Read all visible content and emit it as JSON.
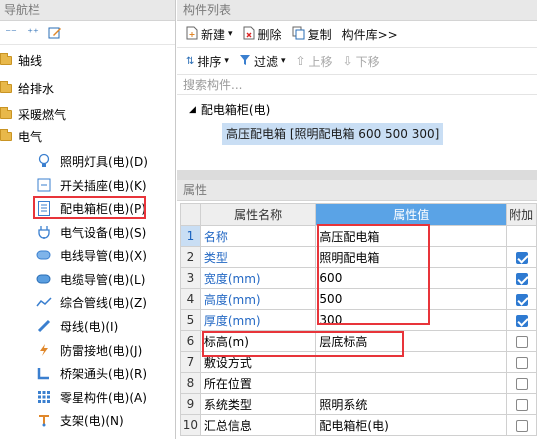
{
  "nav": {
    "title": "导航栏",
    "folders": [
      {
        "label": "轴线"
      },
      {
        "label": "给排水"
      },
      {
        "label": "采暖燃气"
      },
      {
        "label": "电气"
      }
    ],
    "items": [
      {
        "label": "照明灯具(电)(D)",
        "icon": "bulb-icon"
      },
      {
        "label": "开关插座(电)(K)",
        "icon": "switch-icon"
      },
      {
        "label": "配电箱柜(电)(P)",
        "icon": "cabinet-icon"
      },
      {
        "label": "电气设备(电)(S)",
        "icon": "plug-icon"
      },
      {
        "label": "电线导管(电)(X)",
        "icon": "wire-pipe-icon"
      },
      {
        "label": "电缆导管(电)(L)",
        "icon": "cable-pipe-icon"
      },
      {
        "label": "综合管线(电)(Z)",
        "icon": "pipeline-icon"
      },
      {
        "label": "母线(电)(I)",
        "icon": "busbar-icon"
      },
      {
        "label": "防雷接地(电)(J)",
        "icon": "lightning-icon"
      },
      {
        "label": "桥架通头(电)(R)",
        "icon": "bridge-icon"
      },
      {
        "label": "零星构件(电)(A)",
        "icon": "grid-icon"
      },
      {
        "label": "支架(电)(N)",
        "icon": "bracket-icon"
      }
    ]
  },
  "component_list": {
    "title": "构件列表",
    "toolbar": {
      "new": "新建",
      "delete": "删除",
      "copy": "复制",
      "library": "构件库>>",
      "sort": "排序",
      "filter": "过滤",
      "up": "上移",
      "down": "下移"
    },
    "search_placeholder": "搜索构件...",
    "tree_parent": "配电箱柜(电)",
    "tree_child": "高压配电箱 [照明配电箱 600 500 300]"
  },
  "properties": {
    "title": "属性",
    "col_name": "属性名称",
    "col_value": "属性值",
    "col_extra": "附加",
    "rows": [
      {
        "num": "1",
        "name": "名称",
        "value": "高压配电箱",
        "checked": null
      },
      {
        "num": "2",
        "name": "类型",
        "value": "照明配电箱",
        "checked": true
      },
      {
        "num": "3",
        "name": "宽度(mm)",
        "value": "600",
        "checked": true
      },
      {
        "num": "4",
        "name": "高度(mm)",
        "value": "500",
        "checked": true
      },
      {
        "num": "5",
        "name": "厚度(mm)",
        "value": "300",
        "checked": true
      },
      {
        "num": "6",
        "name": "标高(m)",
        "value": "层底标高",
        "checked": false
      },
      {
        "num": "7",
        "name": "敷设方式",
        "value": "",
        "checked": false
      },
      {
        "num": "8",
        "name": "所在位置",
        "value": "",
        "checked": false
      },
      {
        "num": "9",
        "name": "系统类型",
        "value": "照明系统",
        "checked": false
      },
      {
        "num": "10",
        "name": "汇总信息",
        "value": "配电箱柜(电)",
        "checked": false
      }
    ]
  },
  "colors": {
    "highlight_red": "#e8343a",
    "header_blue": "#5aa3e6",
    "link_blue": "#2368c4"
  }
}
